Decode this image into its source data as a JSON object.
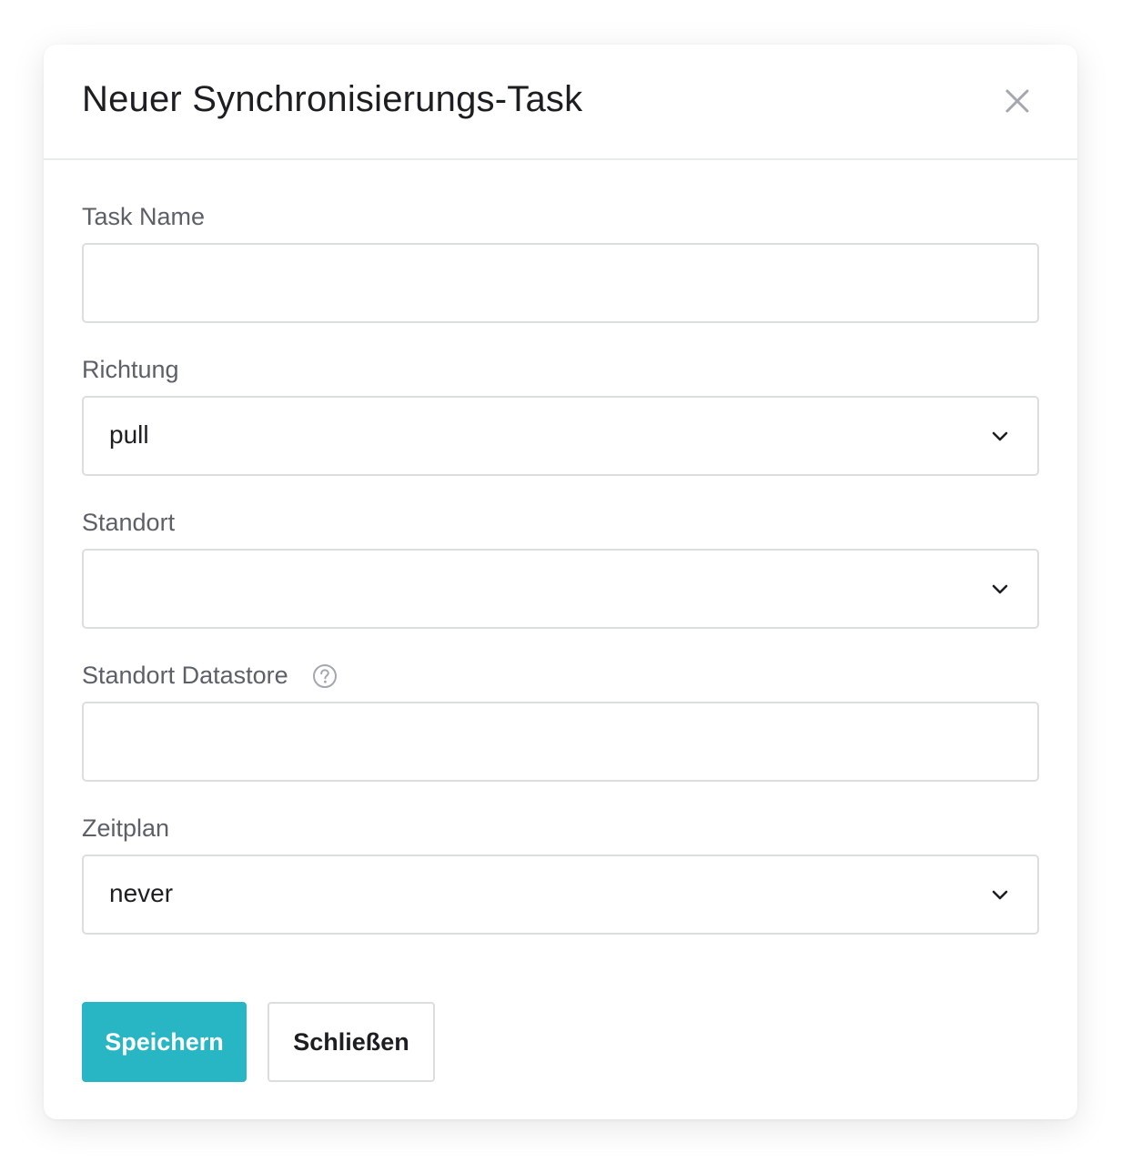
{
  "dialog": {
    "title": "Neuer Synchronisierungs-Task",
    "close_icon": "close-icon"
  },
  "fields": {
    "task_name": {
      "label": "Task Name",
      "value": ""
    },
    "richtung": {
      "label": "Richtung",
      "value": "pull"
    },
    "standort": {
      "label": "Standort",
      "value": ""
    },
    "standort_datastore": {
      "label": "Standort Datastore",
      "value": "",
      "help_icon": "question-circle-icon"
    },
    "zeitplan": {
      "label": "Zeitplan",
      "value": "never"
    }
  },
  "buttons": {
    "save_label": "Speichern",
    "close_label": "Schließen"
  },
  "colors": {
    "primary": "#29b6c4",
    "border": "#dcdde0",
    "label": "#5d6068",
    "text": "#1d1e22"
  }
}
